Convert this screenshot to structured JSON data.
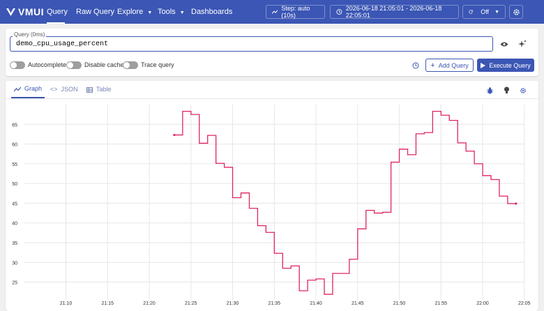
{
  "header": {
    "logo": "VMUI",
    "nav": [
      "Query",
      "Raw Query",
      "Explore",
      "Tools",
      "Dashboards"
    ],
    "step_label": "Step: auto (10s)",
    "time_range": "2026-06-18 21:05:01 - 2026-06-18 22:05:01",
    "refresh_label": "Off"
  },
  "query": {
    "label": "Query (0ms)",
    "value": "demo_cpu_usage_percent"
  },
  "toggles": [
    "Autocomplete",
    "Disable cache",
    "Trace query"
  ],
  "buttons": {
    "add_query": "Add Query",
    "execute_query": "Execute Query"
  },
  "tabs": [
    "Graph",
    "JSON",
    "Table"
  ],
  "colors": {
    "brand": "#3b56b4",
    "series": "#e0245e"
  },
  "icons": [
    "step-icon",
    "clock-icon",
    "refresh-icon",
    "gear-icon",
    "eye-icon",
    "sparkle-icon",
    "history-icon",
    "plus-icon",
    "play-icon",
    "graph-icon",
    "code-icon",
    "table-icon",
    "bug-icon",
    "bulb-icon"
  ],
  "chart_data": {
    "type": "line",
    "xlabel": "",
    "ylabel": "",
    "x_ticks": [
      "21:10",
      "21:15",
      "21:20",
      "21:25",
      "21:30",
      "21:35",
      "21:40",
      "21:45",
      "21:50",
      "21:55",
      "22:00",
      "22:05"
    ],
    "y_ticks": [
      25,
      30,
      35,
      40,
      45,
      50,
      55,
      60,
      65
    ],
    "xlim": [
      "21:05:01",
      "22:05:01"
    ],
    "ylim": [
      20.5,
      70
    ],
    "grid": true,
    "step_interpolation": true,
    "series": [
      {
        "x": [
          "21:23",
          "21:24",
          "21:25",
          "21:26",
          "21:27",
          "21:28",
          "21:29",
          "21:30",
          "21:31",
          "21:32",
          "21:33",
          "21:34",
          "21:35",
          "21:36",
          "21:37",
          "21:38",
          "21:39",
          "21:40",
          "21:41",
          "21:42",
          "21:43",
          "21:44",
          "21:45",
          "21:46",
          "21:47",
          "21:48",
          "21:49",
          "21:50",
          "21:51",
          "21:52",
          "21:53",
          "21:54",
          "21:55",
          "21:56",
          "21:57",
          "21:58",
          "21:59",
          "22:00",
          "22:01",
          "22:02",
          "22:03",
          "22:04"
        ],
        "values": [
          62.3,
          68.3,
          67.5,
          60.2,
          62.2,
          55.1,
          54.1,
          46.4,
          47.6,
          43.7,
          39.3,
          37.6,
          32.3,
          28.5,
          29.1,
          22.8,
          25.5,
          25.8,
          21.9,
          27.2,
          27.2,
          30.8,
          38.5,
          43.2,
          42.5,
          42.7,
          55.4,
          58.7,
          57.3,
          62.6,
          62.9,
          68.3,
          67.3,
          66.0,
          60.3,
          58.2,
          55.0,
          52.0,
          51.0,
          46.8,
          44.9,
          44.9
        ]
      }
    ]
  }
}
